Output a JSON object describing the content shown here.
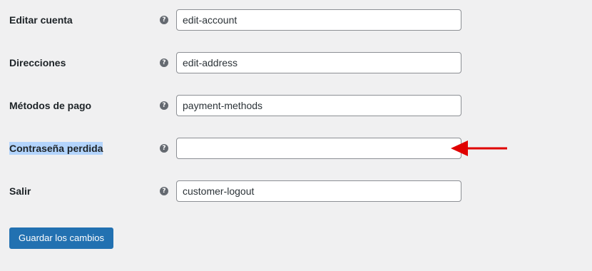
{
  "fields": [
    {
      "label": "Editar cuenta",
      "value": "edit-account",
      "help_icon": "question-circle-icon"
    },
    {
      "label": "Direcciones",
      "value": "edit-address",
      "help_icon": "question-circle-icon"
    },
    {
      "label": "Métodos de pago",
      "value": "payment-methods",
      "help_icon": "question-circle-icon"
    },
    {
      "label": "Contraseña perdida",
      "value": "",
      "help_icon": "question-circle-icon",
      "label_selected": true
    },
    {
      "label": "Salir",
      "value": "customer-logout",
      "help_icon": "question-circle-icon"
    }
  ],
  "help_glyph": "?",
  "annotation": {
    "icon": "arrow-left-icon",
    "color": "#e00000"
  },
  "save_button": {
    "label": "Guardar los cambios"
  },
  "colors": {
    "background": "#f0f0f1",
    "primary_button": "#2271b1",
    "selection_highlight": "#b3d4fc"
  }
}
